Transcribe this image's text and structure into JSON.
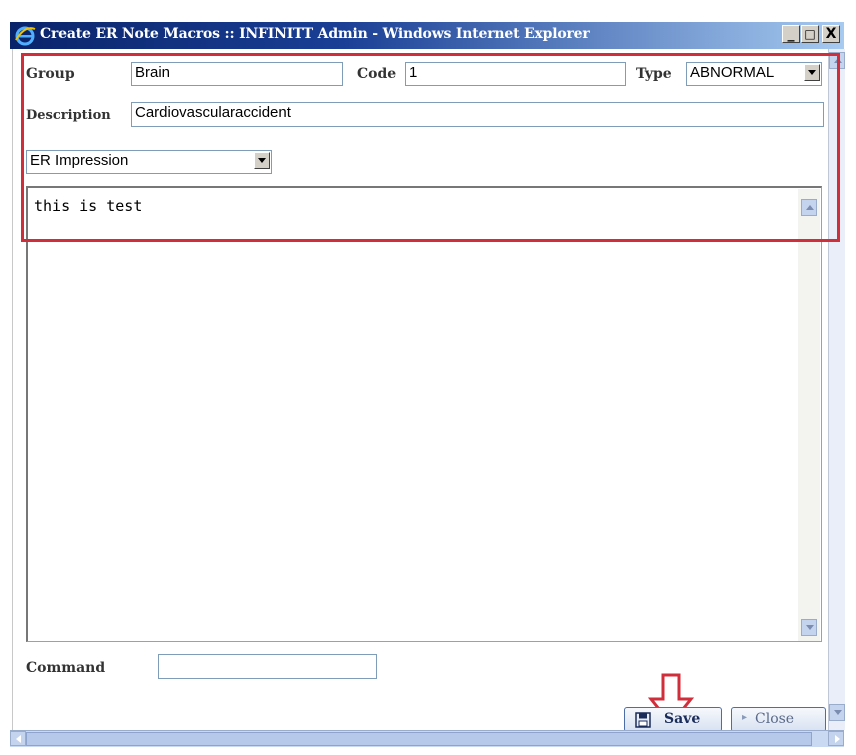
{
  "window": {
    "title": "Create ER Note Macros :: INFINITT Admin - Windows Internet Explorer",
    "minimize": "_",
    "maximize": "□",
    "close": "X"
  },
  "form": {
    "group_label": "Group",
    "group_value": "Brain",
    "code_label": "Code",
    "code_value": "1",
    "type_label": "Type",
    "type_value": "ABNORMAL",
    "description_label": "Description",
    "description_value": "Cardiovascularaccident",
    "section_select": "ER Impression",
    "editor_text": "this is test",
    "command_label": "Command",
    "command_value": ""
  },
  "buttons": {
    "save": "Save",
    "close": "Close"
  },
  "colors": {
    "highlight": "#cf2e3a",
    "titlebar": "#0a246a"
  }
}
